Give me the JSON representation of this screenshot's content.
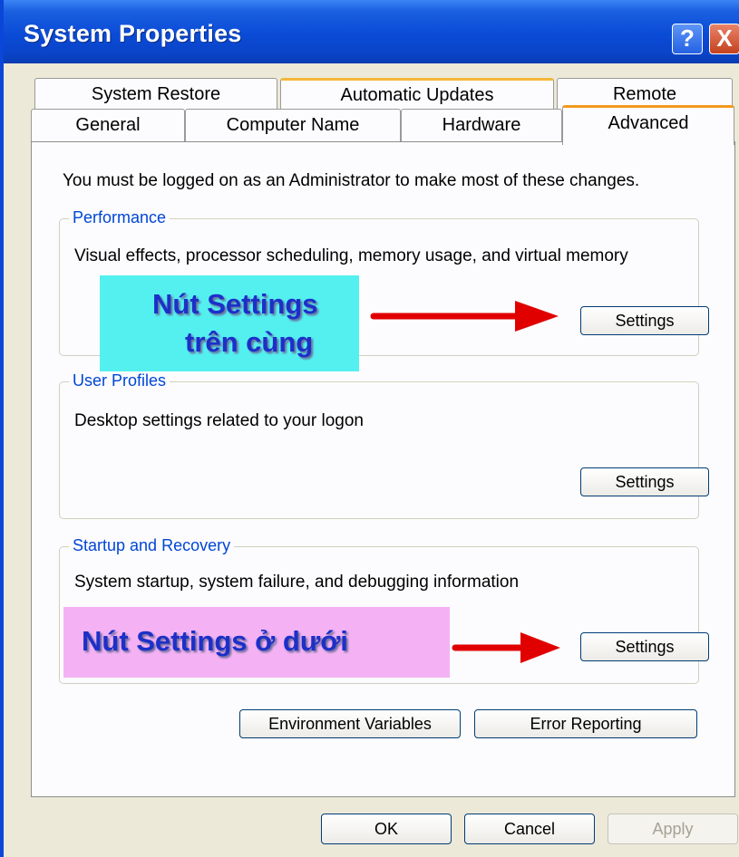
{
  "window": {
    "title": "System Properties"
  },
  "titlebar_buttons": {
    "help": "?",
    "close": "X"
  },
  "tabs": {
    "row1": [
      "System Restore",
      "Automatic Updates",
      "Remote"
    ],
    "row2": [
      "General",
      "Computer Name",
      "Hardware",
      "Advanced"
    ],
    "active": "Advanced"
  },
  "advanced": {
    "admin_note": "You must be logged on as an Administrator to make most of these changes.",
    "performance": {
      "label": "Performance",
      "description": "Visual effects, processor scheduling, memory usage, and virtual memory",
      "button": "Settings"
    },
    "user_profiles": {
      "label": "User Profiles",
      "description": "Desktop settings related to your logon",
      "button": "Settings"
    },
    "startup_recovery": {
      "label": "Startup and Recovery",
      "description": "System startup, system failure, and debugging information",
      "button": "Settings"
    },
    "env_button": "Environment Variables",
    "error_button": "Error Reporting"
  },
  "annotations": {
    "top_line1": "Nút Settings",
    "top_line2": "trên cùng",
    "bottom": "Nút Settings ở dưới"
  },
  "footer": {
    "ok": "OK",
    "cancel": "Cancel",
    "apply": "Apply"
  },
  "colors": {
    "titlebar": "#0a4bd6",
    "group_label": "#0046d5",
    "annotation_text": "#1c30c8",
    "annotation_top_bg": "#54f0f0",
    "annotation_bottom_bg": "#f4b2f4",
    "arrow": "#e00000"
  }
}
